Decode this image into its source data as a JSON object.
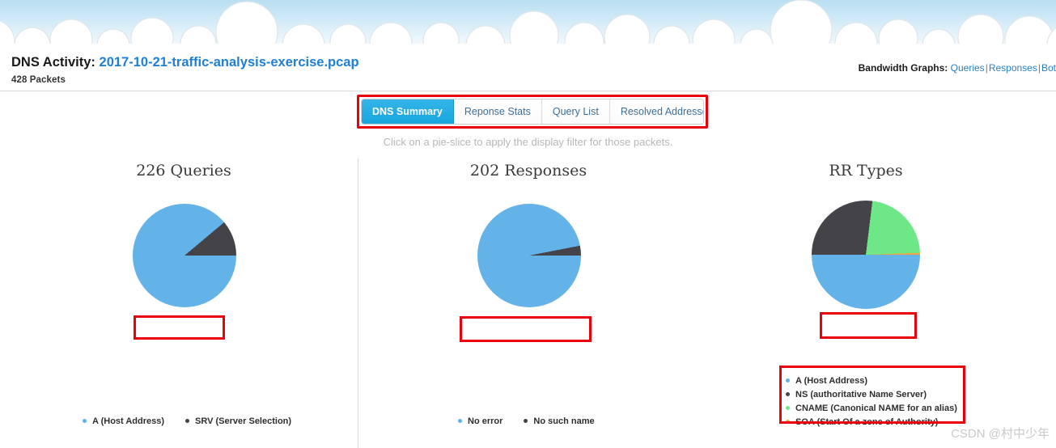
{
  "header": {
    "title_prefix": "DNS Activity:",
    "file_name": "2017-10-21-traffic-analysis-exercise.pcap",
    "packets": "428 Packets",
    "bandwidth_label": "Bandwidth Graphs:",
    "bandwidth_links": [
      "Queries",
      "Responses",
      "Bot"
    ],
    "separator": "|"
  },
  "tabs": [
    {
      "label": "DNS Summary",
      "active": true
    },
    {
      "label": "Reponse Stats",
      "active": false
    },
    {
      "label": "Query List",
      "active": false
    },
    {
      "label": "Resolved Addresses",
      "active": false
    }
  ],
  "hint": "Click on a pie-slice to apply the display filter for those packets.",
  "colors": {
    "series_blue": "#63b3e8",
    "series_dark": "#434348",
    "series_green": "#6ee887",
    "series_orange": "#f4a23c",
    "accent_blue": "#1f7fd4",
    "annotation_red": "#e8000d",
    "tab_active": "#1ba7e0"
  },
  "chart_data": [
    {
      "type": "pie",
      "title": "226 Queries",
      "total": 226,
      "categories": [
        "A (Host Address)",
        "SRV (Server Selection)"
      ],
      "values": [
        201,
        25
      ],
      "percents": [
        88.9,
        11.1
      ],
      "colors": [
        "#63b3e8",
        "#434348"
      ],
      "legend": "bottom"
    },
    {
      "type": "pie",
      "title": "202 Responses",
      "total": 202,
      "categories": [
        "No error",
        "No such name"
      ],
      "values": [
        196,
        6
      ],
      "percents": [
        97.0,
        3.0
      ],
      "colors": [
        "#63b3e8",
        "#434348"
      ],
      "legend": "bottom"
    },
    {
      "type": "pie",
      "title": "RR Types",
      "categories": [
        "A (Host Address)",
        "NS (authoritative Name Server)",
        "CNAME (Canonical NAME for an alias)",
        "SOA (Start Of a zone of Authority)"
      ],
      "values": [
        50,
        27,
        23,
        0.5
      ],
      "percents": [
        50,
        27,
        23,
        0.5
      ],
      "colors": [
        "#63b3e8",
        "#434348",
        "#6ee887",
        "#f4a23c"
      ],
      "legend": "bottom-right"
    }
  ],
  "watermark": "CSDN @村中少年"
}
